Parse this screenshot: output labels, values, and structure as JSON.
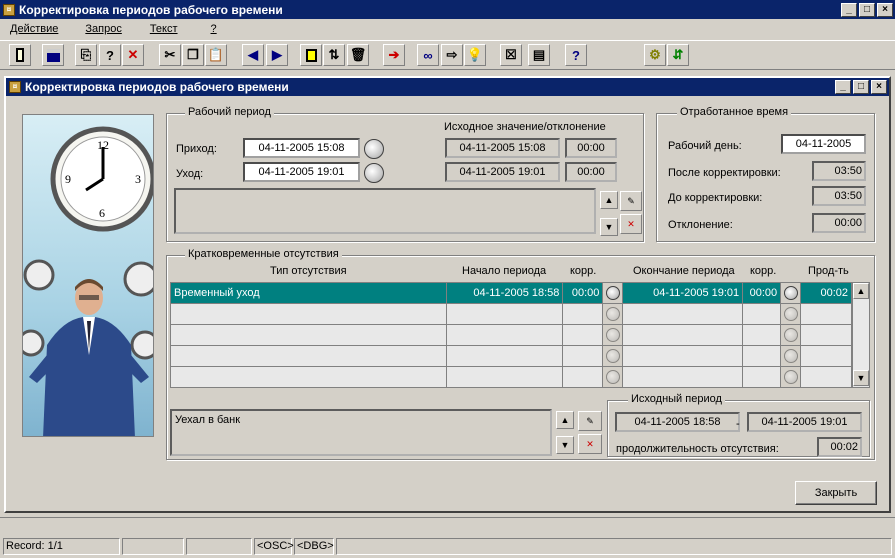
{
  "outer_window": {
    "title": "Корректировка периодов рабочего времени"
  },
  "menu": [
    "Действие",
    "Запрос",
    "Текст",
    "?"
  ],
  "toolbar": [
    "exit-icon",
    "save-icon",
    "copy-record-icon",
    "query-icon",
    "delete-record-icon",
    "cut-icon",
    "copy-icon",
    "paste-icon",
    "prev-icon",
    "next-icon",
    "clipboard-icon",
    "sort-icon",
    "trash-icon",
    "export-icon",
    "binoculars-icon",
    "arrow-icon",
    "lightbulb-icon",
    "close-form-icon",
    "document-icon",
    "help-icon",
    "settings-icon",
    "network-icon"
  ],
  "inner_window": {
    "title": "Корректировка периодов рабочего времени"
  },
  "work_period": {
    "title": "Рабочий период",
    "source_label": "Исходное значение/отклонение",
    "arrival_label": "Приход:",
    "arrival_value": "04-11-2005 15:08",
    "arrival_src": "04-11-2005 15:08",
    "arrival_dev": "00:00",
    "leave_label": "Уход:",
    "leave_value": "04-11-2005 19:01",
    "leave_src": "04-11-2005 19:01",
    "leave_dev": "00:00",
    "comment": ""
  },
  "worked_time": {
    "title": "Отработанное время",
    "workday_label": "Рабочий день:",
    "workday_value": "04-11-2005",
    "after_label": "После корректировки:",
    "after_value": "03:50",
    "before_label": "До корректировки:",
    "before_value": "03:50",
    "dev_label": "Отклонение:",
    "dev_value": "00:00"
  },
  "absences": {
    "title": "Кратковременные отсутствия",
    "columns": [
      "Тип отсутствия",
      "Начало периода",
      "корр.",
      "Окончание периода",
      "корр.",
      "Прод-ть"
    ],
    "rows": [
      {
        "type": "Временный уход",
        "start": "04-11-2005 18:58",
        "start_corr": "00:00",
        "end": "04-11-2005 19:01",
        "end_corr": "00:00",
        "dur": "00:02"
      },
      {
        "type": "",
        "start": "",
        "start_corr": "",
        "end": "",
        "end_corr": "",
        "dur": ""
      },
      {
        "type": "",
        "start": "",
        "start_corr": "",
        "end": "",
        "end_corr": "",
        "dur": ""
      },
      {
        "type": "",
        "start": "",
        "start_corr": "",
        "end": "",
        "end_corr": "",
        "dur": ""
      },
      {
        "type": "",
        "start": "",
        "start_corr": "",
        "end": "",
        "end_corr": "",
        "dur": ""
      }
    ],
    "comment": "Уехал в банк"
  },
  "source_period": {
    "title": "Исходный период",
    "start": "04-11-2005 18:58",
    "sep": "-",
    "end": "04-11-2005 19:01",
    "dur_label": "продолжительность отсутствия:",
    "dur_value": "00:02"
  },
  "close_button": "Закрыть",
  "status": {
    "record": "Record: 1/1",
    "cells": [
      "",
      "",
      "<OSC>",
      "<DBG>"
    ]
  },
  "colors": {
    "title_bar": "#0a246a",
    "selected_row": "#008080"
  }
}
